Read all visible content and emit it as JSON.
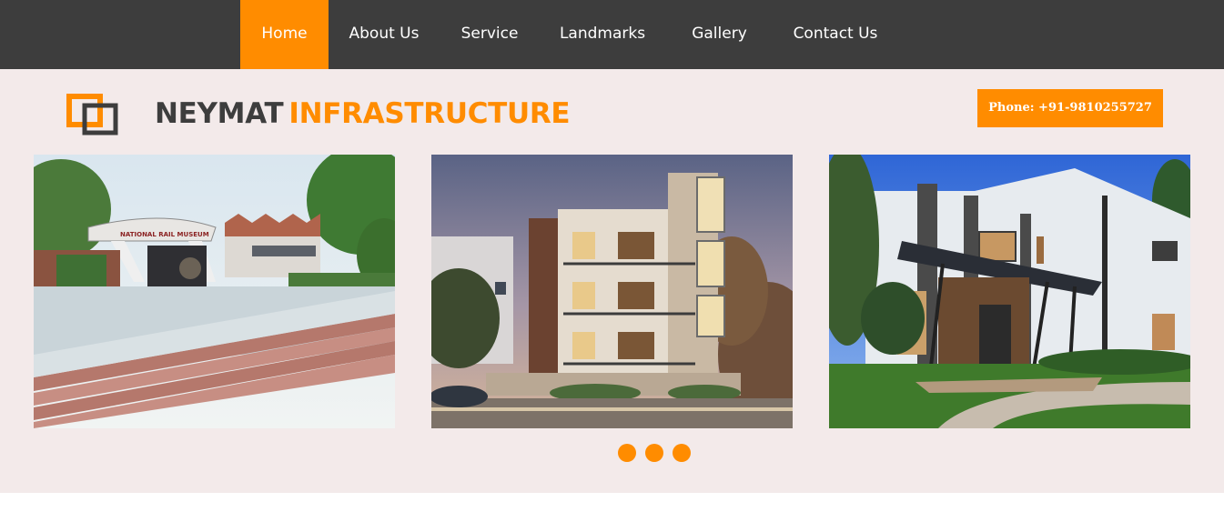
{
  "nav": {
    "items": [
      {
        "label": "Home",
        "active": true
      },
      {
        "label": "About Us",
        "active": false
      },
      {
        "label": "Service",
        "active": false
      },
      {
        "label": "Landmarks",
        "active": false
      },
      {
        "label": "Gallery",
        "active": false
      },
      {
        "label": "Contact Us",
        "active": false
      }
    ]
  },
  "brand": {
    "word1": "NEYMAT",
    "word2": "INFRASTRUCTURE",
    "logo_icon": "overlapping-squares-icon"
  },
  "contact": {
    "phone_label": "Phone: +91-9810255727"
  },
  "slider": {
    "slides": [
      {
        "image": "rail-museum-photo",
        "sign_text": "NATIONAL RAIL MUSEUM"
      },
      {
        "image": "residential-building-photo"
      },
      {
        "image": "modern-house-photo"
      }
    ],
    "dot_count": 3
  },
  "colors": {
    "accent": "#ff8c00",
    "nav_bg": "#3d3d3d",
    "hero_bg": "#f3eaea",
    "brand_dark": "#3d3d3d"
  }
}
